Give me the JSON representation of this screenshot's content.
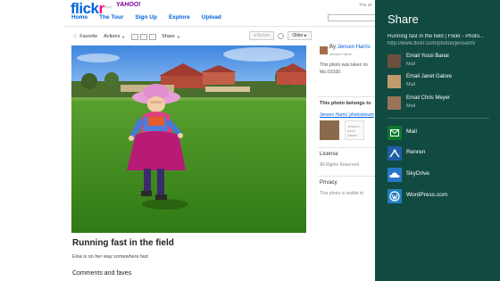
{
  "site": {
    "logo_left": "flick",
    "logo_right": "r",
    "logo_from": "from",
    "logo_yahoo": "YAHOO!",
    "top_right_text": "You ar",
    "nav": [
      "Home",
      "The Tour",
      "Sign Up",
      "Explore",
      "Upload"
    ]
  },
  "toolbar": {
    "favorite": "Favorite",
    "actions": "Actions",
    "share": "Share",
    "newer": "Newer",
    "older": "Older"
  },
  "photo": {
    "title": "Running fast in the field",
    "description": "Elsa is on her way somewhere fast",
    "comments_heading": "Comments and faves"
  },
  "owner": {
    "by": "By",
    "name": "Jensen Harris",
    "sub": "Jensen Harris",
    "taken_text": "This photo was taken on Ma D3100."
  },
  "sidebar": {
    "belongs": "This photo belongs to",
    "set_link": "Jensen Harris' photostream",
    "set_thumb_text": "Jensen's photo stream",
    "license": "License",
    "rights": "All Rights Reserved",
    "privacy": "Privacy",
    "visible": "This photo is visible to"
  },
  "charm": {
    "title": "Share",
    "subtitle": "Running fast in the field | Flickr - Photo...",
    "url": "http://www.flickr.com/photos/jensenh/",
    "contacts": [
      {
        "name": "Email Yossi Banai",
        "app": "Mail"
      },
      {
        "name": "Email Janet Galore",
        "app": "Mail"
      },
      {
        "name": "Email Chris Meyer",
        "app": "Mail"
      }
    ],
    "apps": [
      {
        "label": "Mail",
        "icon": "mail-icon",
        "color": "#0d7a2e"
      },
      {
        "label": "Renren",
        "icon": "renren-icon",
        "color": "#1e5fa8"
      },
      {
        "label": "SkyDrive",
        "icon": "skydrive-icon",
        "color": "#2677c8"
      },
      {
        "label": "WordPress.com",
        "icon": "wordpress-icon",
        "color": "#1f7fc2"
      }
    ]
  },
  "colors": {
    "charm_bg": "#114a40",
    "flickr_blue": "#0063dc",
    "flickr_pink": "#ff0084"
  }
}
